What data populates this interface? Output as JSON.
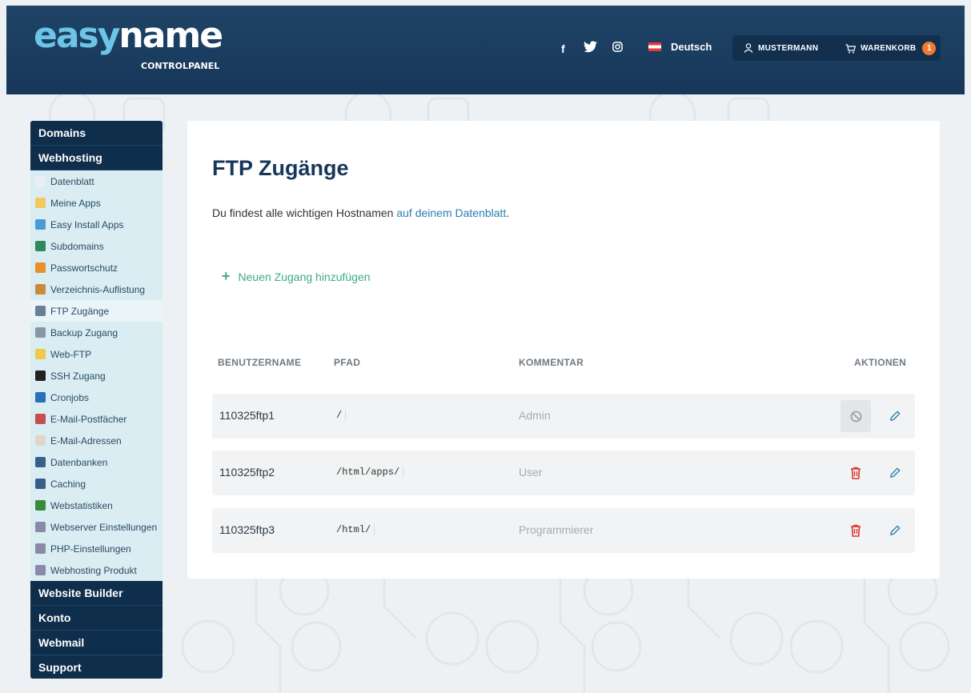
{
  "header": {
    "logo_easy": "easy",
    "logo_name": "name",
    "logo_sub": "CONTROLPANEL",
    "social_icons": [
      "facebook-icon",
      "twitter-icon",
      "instagram-icon"
    ],
    "language": "Deutsch",
    "user": "MUSTERMANN",
    "cart": "WARENKORB",
    "cart_count": "1"
  },
  "sidebar": {
    "sections": {
      "domains": "Domains",
      "webhosting": "Webhosting",
      "website_builder": "Website Builder",
      "konto": "Konto",
      "webmail": "Webmail",
      "support": "Support"
    },
    "items": [
      {
        "label": "Datenblatt",
        "icon": "document-icon",
        "color": "#e8eef5"
      },
      {
        "label": "Meine Apps",
        "icon": "apps-icon",
        "color": "#f3c860"
      },
      {
        "label": "Easy Install Apps",
        "icon": "install-icon",
        "color": "#4a9ad4"
      },
      {
        "label": "Subdomains",
        "icon": "globe-icon",
        "color": "#2e8a5a"
      },
      {
        "label": "Passwortschutz",
        "icon": "key-icon",
        "color": "#e8902a"
      },
      {
        "label": "Verzeichnis-Auflistung",
        "icon": "folder-lock-icon",
        "color": "#c98a3c"
      },
      {
        "label": "FTP Zugänge",
        "icon": "ftp-icon",
        "color": "#6b7f99"
      },
      {
        "label": "Backup Zugang",
        "icon": "backup-icon",
        "color": "#8a96a3"
      },
      {
        "label": "Web-FTP",
        "icon": "folder-icon",
        "color": "#f0c84a"
      },
      {
        "label": "SSH Zugang",
        "icon": "terminal-icon",
        "color": "#222222"
      },
      {
        "label": "Cronjobs",
        "icon": "clock-icon",
        "color": "#2b6fb8"
      },
      {
        "label": "E-Mail-Postfächer",
        "icon": "mailbox-icon",
        "color": "#c54f4f"
      },
      {
        "label": "E-Mail-Adressen",
        "icon": "mail-icon",
        "color": "#e0d6c8"
      },
      {
        "label": "Datenbanken",
        "icon": "database-icon",
        "color": "#3a5d8c"
      },
      {
        "label": "Caching",
        "icon": "cache-icon",
        "color": "#3a5d8c"
      },
      {
        "label": "Webstatistiken",
        "icon": "chart-icon",
        "color": "#3a8a3a"
      },
      {
        "label": "Webserver Einstellungen",
        "icon": "settings-icon",
        "color": "#8a8aa8"
      },
      {
        "label": "PHP-Einstellungen",
        "icon": "settings-icon",
        "color": "#8a8aa8"
      },
      {
        "label": "Webhosting Produkt",
        "icon": "settings-icon",
        "color": "#8a8aa8"
      }
    ],
    "active_index": 6
  },
  "main": {
    "title": "FTP Zugänge",
    "desc_text": "Du findest alle wichtigen Hostnamen ",
    "desc_link": "auf deinem Datenblatt",
    "desc_end": ".",
    "add_label": "Neuen Zugang hinzufügen",
    "table": {
      "headers": [
        "BENUTZERNAME",
        "PFAD",
        "KOMMENTAR",
        "AKTIONEN"
      ],
      "rows": [
        {
          "user": "110325ftp1",
          "path": "/",
          "comment": "Admin",
          "delete": "disabled"
        },
        {
          "user": "110325ftp2",
          "path": "/html/apps/",
          "comment": "User",
          "delete": "enabled"
        },
        {
          "user": "110325ftp3",
          "path": "/html/",
          "comment": "Programmierer",
          "delete": "enabled"
        }
      ]
    }
  },
  "colors": {
    "header": "#1f4466",
    "accent_green": "#3eac80",
    "link": "#2b7fb0",
    "delete": "#d9342b",
    "cart_badge": "#f07a32"
  }
}
